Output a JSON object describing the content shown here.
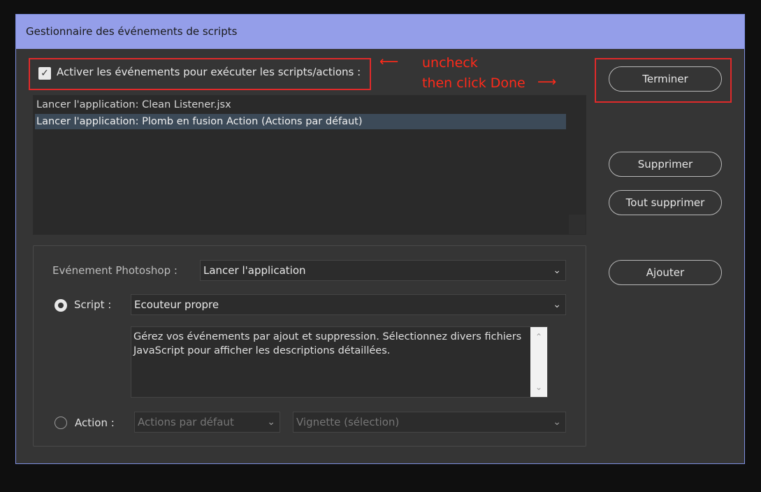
{
  "dialog": {
    "title": "Gestionnaire des événements de scripts",
    "enable_label": "Activer les événements pour exécuter les scripts/actions :",
    "enable_checked": true
  },
  "annotation": {
    "line1": "uncheck",
    "line2": "then click Done",
    "arrow_left": "⟵",
    "arrow_right": "⟶"
  },
  "events_list": [
    "Lancer l'application: Clean Listener.jsx",
    "Lancer l'application: Plomb en fusion Action (Actions par défaut)"
  ],
  "buttons": {
    "done": "Terminer",
    "remove": "Supprimer",
    "remove_all": "Tout supprimer",
    "add": "Ajouter"
  },
  "form": {
    "event_label": "Evénement Photoshop :",
    "event_value": "Lancer l'application",
    "script_label": "Script :",
    "script_value": "Ecouteur propre",
    "description": "Gérez vos événements par ajout et suppression. Sélectionnez divers fichiers JavaScript pour afficher les descriptions détaillées.",
    "action_label": "Action :",
    "action_set_value": "Actions par défaut",
    "action_value": "Vignette (sélection)"
  },
  "icons": {
    "chevron": "⌄",
    "check": "✓",
    "up": "⌃",
    "down": "⌄"
  },
  "colors": {
    "titlebar": "#949ee9",
    "highlight_box": "#e02a2a",
    "selected_row": "#3c4a58"
  }
}
